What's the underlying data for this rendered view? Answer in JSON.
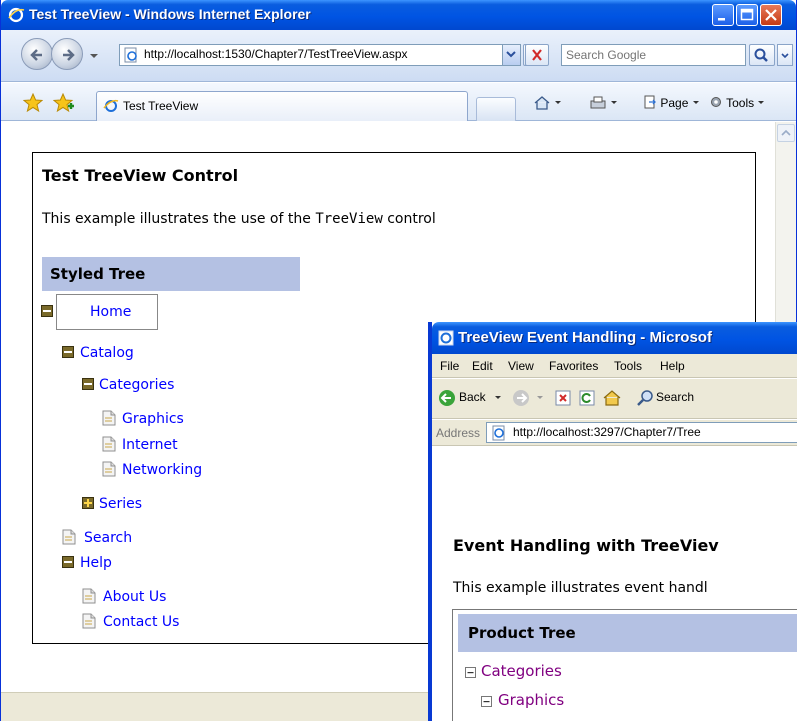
{
  "window1": {
    "title": "Test TreeView - Windows Internet Explorer",
    "address_url": "http://localhost:1530/Chapter7/TestTreeView.aspx",
    "search_placeholder": "Search Google",
    "tab_label": "Test TreeView",
    "commands": {
      "page": "Page",
      "tools": "Tools"
    },
    "page": {
      "heading": "Test TreeView Control",
      "description_prefix": "This example illustrates the use of the ",
      "description_code": "TreeView",
      "description_suffix": " control",
      "tree_header": "Styled Tree",
      "tree": {
        "home": "Home",
        "catalog": "Catalog",
        "categories": "Categories",
        "graphics": "Graphics",
        "internet": "Internet",
        "networking": "Networking",
        "series": "Series",
        "search": "Search",
        "help": "Help",
        "about_us": "About Us",
        "contact_us": "Contact Us"
      }
    }
  },
  "window2": {
    "title": "TreeView Event Handling - Microsof",
    "menu": [
      "File",
      "Edit",
      "View",
      "Favorites",
      "Tools",
      "Help"
    ],
    "toolbar": {
      "back": "Back",
      "search": "Search"
    },
    "address_label": "Address",
    "address_url": "http://localhost:3297/Chapter7/Tree",
    "page": {
      "heading": "Event Handling with TreeViev",
      "description": "This example illustrates event handl",
      "tree_header": "Product Tree",
      "tree": {
        "categories": "Categories",
        "graphics": "Graphics"
      }
    }
  },
  "colors": {
    "titlebar_blue": "#0054e3",
    "tree_header_bg": "#b4c1e3",
    "link_blue": "#0000ff",
    "visited_purple": "#800080"
  }
}
